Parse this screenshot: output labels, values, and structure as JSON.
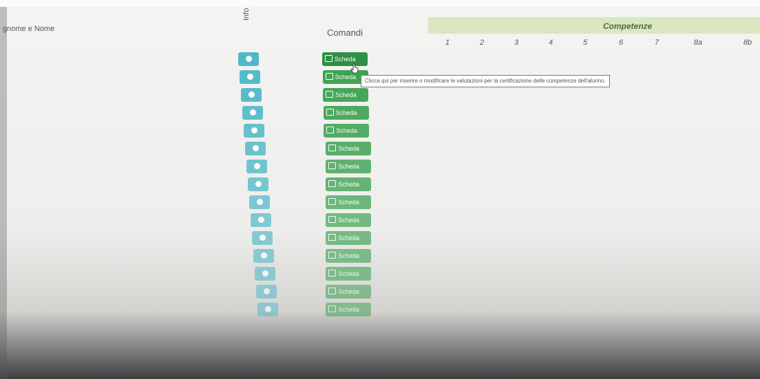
{
  "header": {
    "name_col": "gnome e Nome",
    "info_col": "Info",
    "comandi_col": "Comandi",
    "competenze_title": "Competenze",
    "competenze_cols": [
      "1",
      "2",
      "3",
      "4",
      "5",
      "6",
      "7",
      "8a",
      "8b"
    ]
  },
  "rows": {
    "button_label": "Scheda",
    "count": 15
  },
  "tooltip": {
    "text": "Clicca qui per inserire o modificare le valutazioni per la certificazione delle competenze dell'alunno."
  },
  "colors": {
    "info_button": "#4fb9c8",
    "scheda_button": "#3aa14f",
    "competenze_band": "#d9e7c2"
  },
  "icons": {
    "info": "info-circle-icon",
    "edit": "edit-icon",
    "cursor": "hand-cursor-icon"
  }
}
